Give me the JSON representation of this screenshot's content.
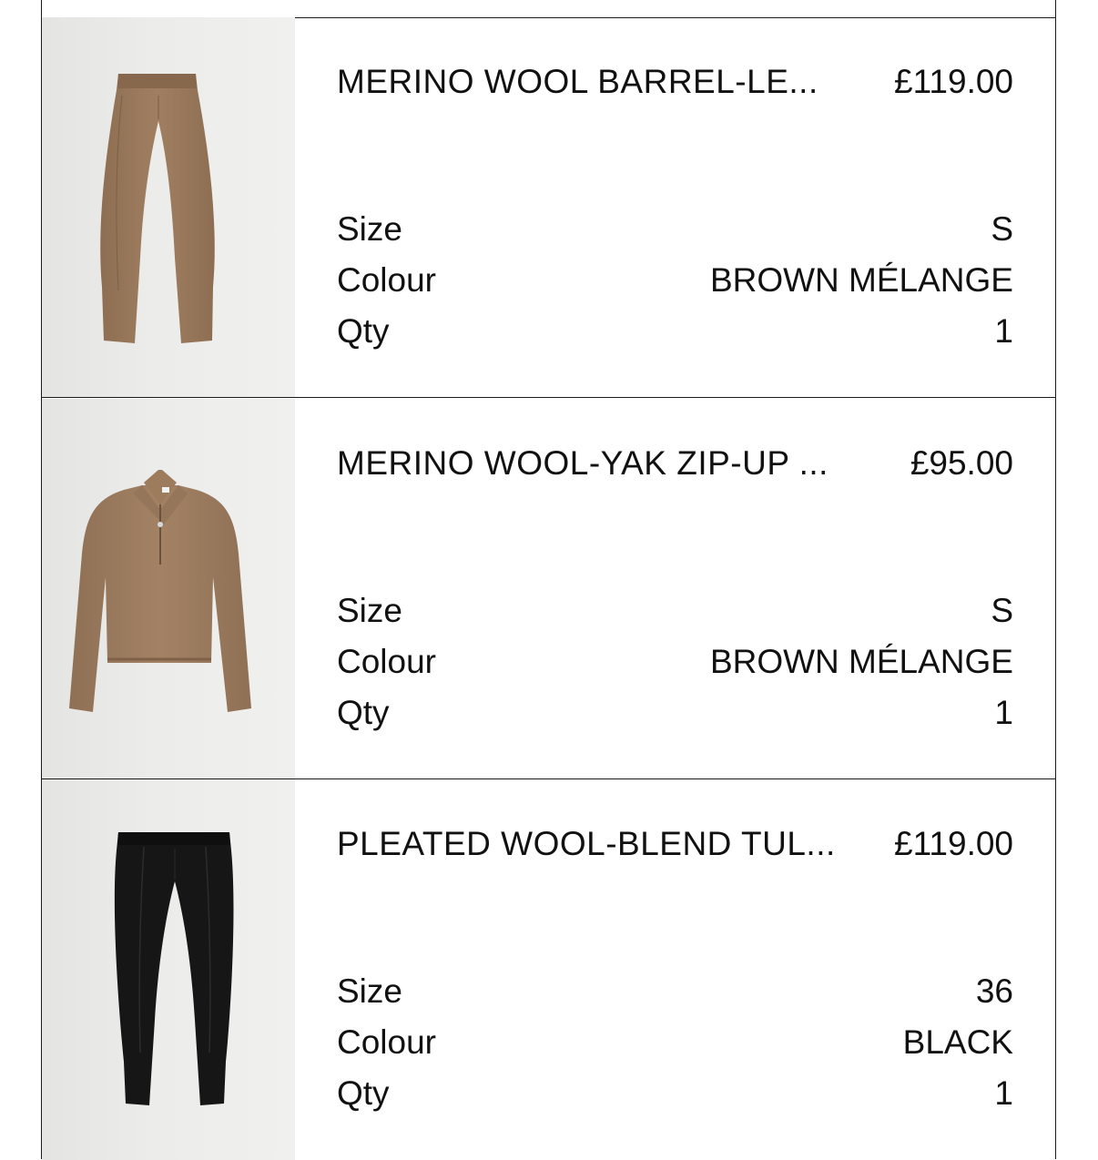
{
  "cart": {
    "items": [
      {
        "name": "MERINO WOOL BARREL-LE...",
        "price": "£119.00",
        "image_icon": "brown-knit-trousers",
        "color_hex": "#9a7a5c",
        "size_label": "Size",
        "size_value": "S",
        "colour_label": "Colour",
        "colour_value": "BROWN MÉLANGE",
        "qty_label": "Qty",
        "qty_value": "1"
      },
      {
        "name": "MERINO WOOL-YAK ZIP-UP ...",
        "price": "£95.00",
        "image_icon": "brown-zip-up-knit-sweater",
        "color_hex": "#9c7b5e",
        "size_label": "Size",
        "size_value": "S",
        "colour_label": "Colour",
        "colour_value": "BROWN MÉLANGE",
        "qty_label": "Qty",
        "qty_value": "1"
      },
      {
        "name": "PLEATED WOOL-BLEND TUL...",
        "price": "£119.00",
        "image_icon": "black-pleated-trousers",
        "color_hex": "#151515",
        "size_label": "Size",
        "size_value": "36",
        "colour_label": "Colour",
        "colour_value": "BLACK",
        "qty_label": "Qty",
        "qty_value": "1"
      }
    ]
  }
}
